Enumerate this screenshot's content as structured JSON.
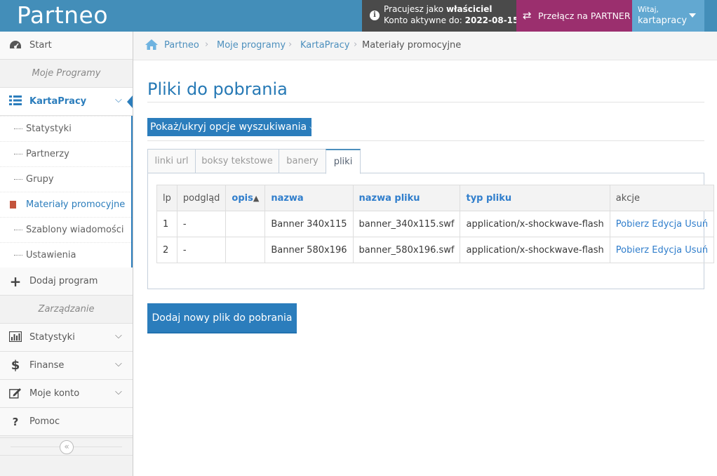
{
  "navbar": {
    "logo": "Partneo",
    "info_line1_prefix": "Pracujesz jako ",
    "info_line1_role": "właściciel",
    "info_line2_prefix": "Konto aktywne do: ",
    "info_line2_date": "2022-08-15",
    "switch_label": "Przełącz na PARTNER",
    "user_greeting": "Witaj,",
    "user_name": "kartapracy",
    "colors": {
      "bar": "#438eb9",
      "info": "#4a4a4a",
      "switch": "#9b2f6e",
      "user": "#62a8d1"
    }
  },
  "sidebar": {
    "start": "Start",
    "header_programs": "Moje Programy",
    "program": "KartaPracy",
    "submenu": [
      "Statystyki",
      "Partnerzy",
      "Grupy",
      "Materiały promocyjne",
      "Szablony wiadomości",
      "Ustawienia"
    ],
    "add_program": "Dodaj program",
    "header_manage": "Zarządzanie",
    "statystyki": "Statystyki",
    "finanse": "Finanse",
    "moje_konto": "Moje konto",
    "pomoc": "Pomoc"
  },
  "breadcrumb": {
    "items": [
      "Partneo",
      "Moje programy",
      "KartaPracy",
      "Materiały promocyjne"
    ]
  },
  "main": {
    "title": "Pliki do pobrania",
    "toggle_search": "Pokaż/ukryj opcje wyszukiwania",
    "tabs": [
      "linki url",
      "boksy tekstowe",
      "banery",
      "pliki"
    ],
    "table": {
      "headers": [
        "lp",
        "podgląd",
        "opis",
        "nazwa",
        "nazwa pliku",
        "typ pliku",
        "akcje"
      ],
      "rows": [
        {
          "lp": "1",
          "preview": "-",
          "desc": "",
          "name": "Banner 340x115",
          "file": "banner_340x115.swf",
          "type": "application/x-shockwave-flash"
        },
        {
          "lp": "2",
          "preview": "-",
          "desc": "",
          "name": "Banner 580x196",
          "file": "banner_580x196.swf",
          "type": "application/x-shockwave-flash"
        }
      ],
      "actions": [
        "Pobierz",
        "Edycja",
        "Usuń"
      ]
    },
    "add_button": "Dodaj nowy plik do pobrania"
  }
}
